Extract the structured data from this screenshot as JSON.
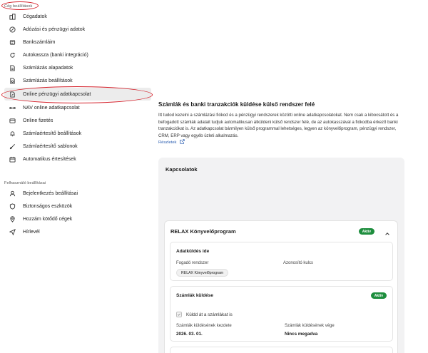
{
  "sidebar": {
    "section1_label": "Cég beállítások",
    "items": [
      {
        "label": "Cégadatok",
        "icon": "building-icon"
      },
      {
        "label": "Adózási és pénzügyi adatok",
        "icon": "percent-icon"
      },
      {
        "label": "Bankszámláim",
        "icon": "bank-icon"
      },
      {
        "label": "Autokassza (banki integráció)",
        "icon": "sync-icon"
      },
      {
        "label": "Számlázás alapadatok",
        "icon": "document-icon"
      },
      {
        "label": "Számlázás beállítások",
        "icon": "document-settings-icon"
      },
      {
        "label": "Online pénzügyi adatkapcsolat",
        "icon": "link-document-icon",
        "active": true
      },
      {
        "label": "NAV online adatkapcsolat",
        "icon": "connection-icon"
      },
      {
        "label": "Online fizetés",
        "icon": "payment-icon"
      },
      {
        "label": "Számlaértesítő beállítások",
        "icon": "bell-icon"
      },
      {
        "label": "Számlaértesítő sablonok",
        "icon": "brush-icon"
      },
      {
        "label": "Automatikus értesítések",
        "icon": "calendar-icon"
      }
    ],
    "section2_label": "Felhasználó beállításai",
    "user_items": [
      {
        "label": "Bejelentkezés beállításai",
        "icon": "user-icon"
      },
      {
        "label": "Biztonságos eszközök",
        "icon": "shield-icon"
      },
      {
        "label": "Hozzám kötődő cégek",
        "icon": "pin-icon"
      },
      {
        "label": "Hírlevél",
        "icon": "send-icon"
      }
    ]
  },
  "main": {
    "title": "Számlák és banki tranzakciók küldése külső rendszer felé",
    "description": "Itt tudod kezelni a számlázási fiókod és a pénzügyi rendszerek közötti online adatkapcsolatokat. Nem csak a kibocsátott és a befogadott számlák adatait tudjuk automatikusan átküldeni külső rendszer felé, de az autokasszával a fiókodba érkező banki tranzakciókat is. Az adatkapcsolat bármilyen külső programmal lehetséges, legyen az könyvelőprogram, pénzügyi rendszer, CRM, ERP vagy egyéb üzleti alkalmazás.",
    "more_link": "Részletek",
    "panel": {
      "title": "Kapcsolatok",
      "card": {
        "title": "RELAX Könyvelőprogram",
        "status": "Aktív",
        "destination": {
          "heading": "Adatküldés ide",
          "receiver_label": "Fogadó rendszer",
          "receiver_value": "RELAX Könyvelőprogram",
          "id_label": "Azonosító kulcs"
        },
        "invoice_sending": {
          "heading": "Számlák küldése",
          "status": "Aktív",
          "checkbox_label": "Küldd át a számlákat is",
          "start_label": "Számlák küldésének kezdete",
          "start_value": "2026. 03. 01.",
          "end_label": "Számlák küldésének vége",
          "end_value": "Nincs megadva"
        }
      }
    }
  },
  "colors": {
    "accent_green": "#1e8e3e",
    "highlight_red": "#d4202a",
    "link_blue": "#2a5db0"
  }
}
